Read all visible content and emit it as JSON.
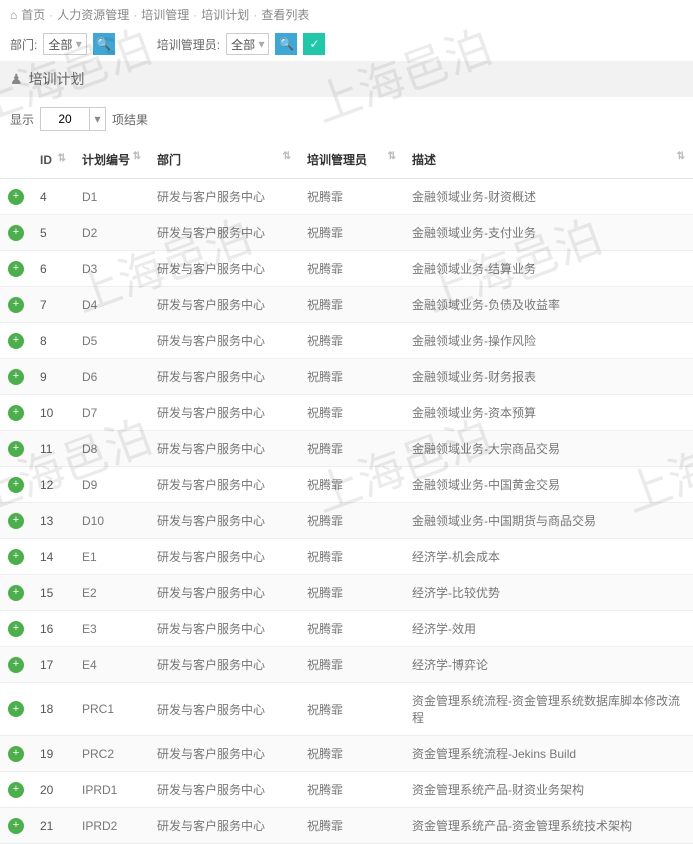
{
  "breadcrumb": {
    "home": "首页",
    "l1": "人力资源管理",
    "l2": "培训管理",
    "l3": "培训计划",
    "l4": "查看列表"
  },
  "filters": {
    "f1_label": "部门:",
    "f1_value": "全部",
    "f2_label": "培训管理员:",
    "f2_value": "全部"
  },
  "panel": {
    "title": "培训计划"
  },
  "showbar": {
    "show": "显示",
    "count": "20",
    "results": "项结果"
  },
  "headers": {
    "id": "ID",
    "plan": "计划编号",
    "dept": "部门",
    "mgr": "培训管理员",
    "desc": "描述"
  },
  "rows": [
    {
      "id": "4",
      "plan": "D1",
      "dept": "研发与客户服务中心",
      "mgr": "祝腾霏",
      "desc": "金融领域业务-财资概述"
    },
    {
      "id": "5",
      "plan": "D2",
      "dept": "研发与客户服务中心",
      "mgr": "祝腾霏",
      "desc": "金融领域业务-支付业务"
    },
    {
      "id": "6",
      "plan": "D3",
      "dept": "研发与客户服务中心",
      "mgr": "祝腾霏",
      "desc": "金融领域业务-结算业务"
    },
    {
      "id": "7",
      "plan": "D4",
      "dept": "研发与客户服务中心",
      "mgr": "祝腾霏",
      "desc": "金融领域业务-负债及收益率"
    },
    {
      "id": "8",
      "plan": "D5",
      "dept": "研发与客户服务中心",
      "mgr": "祝腾霏",
      "desc": "金融领域业务-操作风险"
    },
    {
      "id": "9",
      "plan": "D6",
      "dept": "研发与客户服务中心",
      "mgr": "祝腾霏",
      "desc": "金融领域业务-财务报表"
    },
    {
      "id": "10",
      "plan": "D7",
      "dept": "研发与客户服务中心",
      "mgr": "祝腾霏",
      "desc": "金融领域业务-资本预算"
    },
    {
      "id": "11",
      "plan": "D8",
      "dept": "研发与客户服务中心",
      "mgr": "祝腾霏",
      "desc": "金融领域业务-大宗商品交易"
    },
    {
      "id": "12",
      "plan": "D9",
      "dept": "研发与客户服务中心",
      "mgr": "祝腾霏",
      "desc": "金融领域业务-中国黄金交易"
    },
    {
      "id": "13",
      "plan": "D10",
      "dept": "研发与客户服务中心",
      "mgr": "祝腾霏",
      "desc": "金融领域业务-中国期货与商品交易"
    },
    {
      "id": "14",
      "plan": "E1",
      "dept": "研发与客户服务中心",
      "mgr": "祝腾霏",
      "desc": "经济学-机会成本"
    },
    {
      "id": "15",
      "plan": "E2",
      "dept": "研发与客户服务中心",
      "mgr": "祝腾霏",
      "desc": "经济学-比较优势"
    },
    {
      "id": "16",
      "plan": "E3",
      "dept": "研发与客户服务中心",
      "mgr": "祝腾霏",
      "desc": "经济学-效用"
    },
    {
      "id": "17",
      "plan": "E4",
      "dept": "研发与客户服务中心",
      "mgr": "祝腾霏",
      "desc": "经济学-博弈论"
    },
    {
      "id": "18",
      "plan": "PRC1",
      "dept": "研发与客户服务中心",
      "mgr": "祝腾霏",
      "desc": "资金管理系统流程-资金管理系统数据库脚本修改流程"
    },
    {
      "id": "19",
      "plan": "PRC2",
      "dept": "研发与客户服务中心",
      "mgr": "祝腾霏",
      "desc": "资金管理系统流程-Jekins Build"
    },
    {
      "id": "20",
      "plan": "IPRD1",
      "dept": "研发与客户服务中心",
      "mgr": "祝腾霏",
      "desc": "资金管理系统产品-财资业务架构"
    },
    {
      "id": "21",
      "plan": "IPRD2",
      "dept": "研发与客户服务中心",
      "mgr": "祝腾霏",
      "desc": "资金管理系统产品-资金管理系统技术架构"
    }
  ],
  "watermark": "上海邑泊"
}
